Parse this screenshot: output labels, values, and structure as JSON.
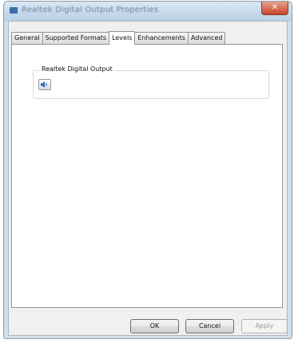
{
  "window": {
    "title": "Realtek Digital Output Properties",
    "close_glyph": "✕"
  },
  "tabs": [
    {
      "label": "General",
      "active": false
    },
    {
      "label": "Supported Formats",
      "active": false
    },
    {
      "label": "Levels",
      "active": true
    },
    {
      "label": "Enhancements",
      "active": false
    },
    {
      "label": "Advanced",
      "active": false
    }
  ],
  "levels": {
    "group_label": "Realtek Digital Output",
    "speaker_icon": "speaker-icon"
  },
  "buttons": {
    "ok": "OK",
    "cancel": "Cancel",
    "apply": "Apply"
  },
  "colors": {
    "title_bar": "#c8dceb",
    "close_button": "#c8432a",
    "panel_background": "#ffffff",
    "dialog_background": "#f0f0f0"
  }
}
